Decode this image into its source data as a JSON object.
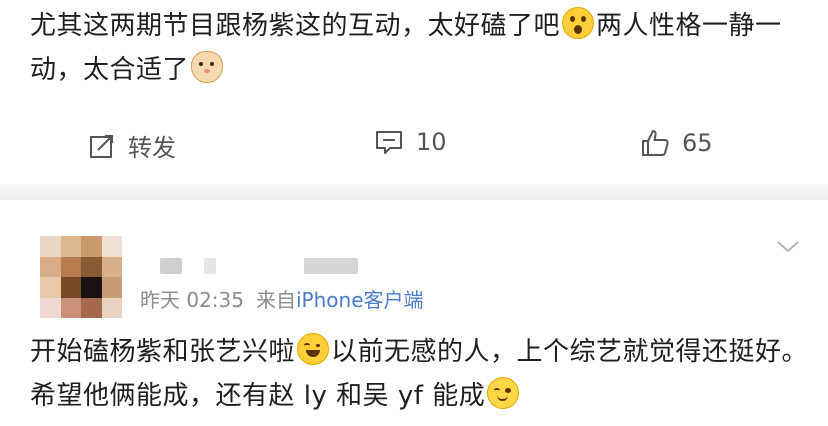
{
  "post1": {
    "text_a": "尤其这两期节目跟杨紫这的互动，太好磕了吧",
    "text_b": "两人性格一静一动，太合适了",
    "emoji_1": "shocked-face-icon",
    "emoji_2": "cat-face-icon"
  },
  "actions": {
    "repost_label": "转发",
    "comment_count": "10",
    "like_count": "65"
  },
  "comment": {
    "time": "昨天 02:35",
    "source_prefix": "来自",
    "source": "iPhone客户端",
    "text_a": "开始磕杨紫和张艺兴啦",
    "text_b": "以前无感的人，上个综艺就觉得还挺好。希望他俩能成，还有赵 ly 和吴 yf 能成",
    "emoji_1": "laugh-cry-face-icon",
    "emoji_2": "smile-face-icon"
  },
  "colors": {
    "text": "#1f1f1f",
    "meta": "#8c8c8c",
    "link": "#4a7cc7",
    "action": "#555555"
  }
}
